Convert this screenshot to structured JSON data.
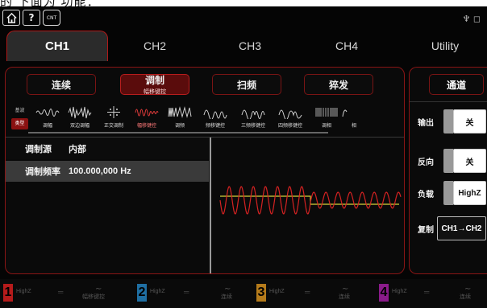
{
  "top_strip_text": "的   下面为    功能：",
  "status_icons": [
    {
      "name": "home-icon"
    },
    {
      "name": "help-icon",
      "text": "?"
    },
    {
      "name": "counter-icon",
      "text": "CNT"
    }
  ],
  "usb_text": "♆ ◻",
  "tabs": [
    "CH1",
    "CH2",
    "CH3",
    "CH4",
    "Utility"
  ],
  "modes": [
    {
      "label": "连续",
      "sub": ""
    },
    {
      "label": "调制",
      "sub": "幅移键控"
    },
    {
      "label": "扫频",
      "sub": ""
    },
    {
      "label": "猝发",
      "sub": ""
    }
  ],
  "wave_tag": {
    "top": "基波",
    "bottom": "类型"
  },
  "waveforms": [
    {
      "label": "调幅",
      "icon": "am-wave-icon"
    },
    {
      "label": "双边调幅",
      "icon": "dsb-am-wave-icon"
    },
    {
      "label": "正交调制",
      "icon": "qam-icon"
    },
    {
      "label": "幅移键控",
      "icon": "ask-wave-icon"
    },
    {
      "label": "调频",
      "icon": "fm-wave-icon"
    },
    {
      "label": "频移键控",
      "icon": "fsk-wave-icon"
    },
    {
      "label": "三频移键控",
      "icon": "3fsk-wave-icon"
    },
    {
      "label": "四频移键控",
      "icon": "4fsk-wave-icon"
    },
    {
      "label": "调相",
      "icon": "pm-wave-icon"
    },
    {
      "label": "相",
      "icon": "psk-wave-icon"
    }
  ],
  "params": [
    {
      "key": "调制源",
      "value": "内部"
    },
    {
      "key": "调制频率",
      "value": "100.000,000 Hz"
    }
  ],
  "right": {
    "title": "通道",
    "rows": [
      {
        "key": "输出",
        "value": "关"
      },
      {
        "key": "反向",
        "value": "关"
      },
      {
        "key": "负载",
        "value": "HighZ"
      },
      {
        "key": "复制",
        "value": "CH1→CH2"
      }
    ]
  },
  "bottom_channels": [
    {
      "num": "1",
      "impedance": "HighZ",
      "mode": "幅移键控",
      "color": "#b51b1b"
    },
    {
      "num": "2",
      "impedance": "HighZ",
      "mode": "连续",
      "color": "#1f6fa3"
    },
    {
      "num": "3",
      "impedance": "HighZ",
      "mode": "连续",
      "color": "#b57b1b"
    },
    {
      "num": "4",
      "impedance": "HighZ",
      "mode": "连续",
      "color": "#8a1b8a"
    }
  ],
  "colors": {
    "accent": "#b01818",
    "signal_yellow": "#d8d23a",
    "signal_red": "#d42222"
  }
}
